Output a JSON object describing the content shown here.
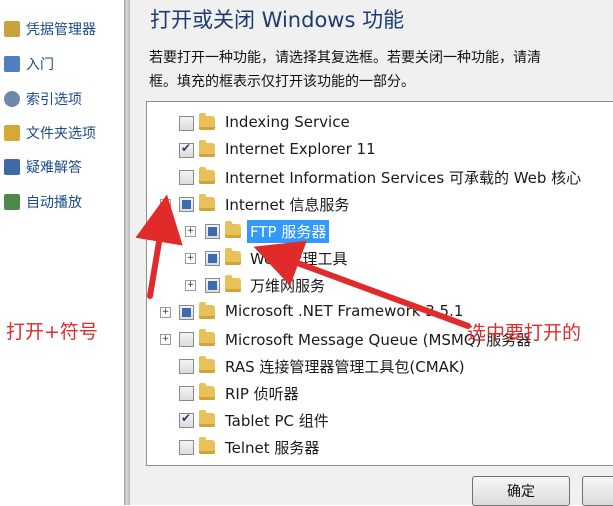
{
  "sidebar": {
    "items": [
      {
        "label": "凭据管理器",
        "icon": "credential-manager-icon",
        "color": "#c9a23c"
      },
      {
        "label": "入门",
        "icon": "getting-started-icon",
        "color": "#4f7fbf"
      },
      {
        "label": "索引选项",
        "icon": "indexing-options-icon",
        "color": "#6d88a8"
      },
      {
        "label": "文件夹选项",
        "icon": "folder-options-icon",
        "color": "#d4a935"
      },
      {
        "label": "疑难解答",
        "icon": "troubleshooting-icon",
        "color": "#3f6aa8"
      },
      {
        "label": "自动播放",
        "icon": "autoplay-icon",
        "color": "#4d8a4a"
      }
    ]
  },
  "dialog": {
    "title": "打开或关闭 Windows 功能",
    "description_line1": "若要打开一种功能，请选择其复选框。若要关闭一种功能，请清",
    "description_line2": "框。填充的框表示仅打开该功能的一部分。",
    "ok_label": "确定"
  },
  "features": [
    {
      "label": "Indexing Service",
      "state": "unchecked",
      "expander": "none",
      "level": 0
    },
    {
      "label": "Internet Explorer 11",
      "state": "checked",
      "expander": "none",
      "level": 0
    },
    {
      "label": "Internet Information Services 可承载的 Web 核心",
      "state": "unchecked",
      "expander": "none",
      "level": 0
    },
    {
      "label": "Internet 信息服务",
      "state": "partial",
      "expander": "minus",
      "level": 0
    },
    {
      "label": "FTP 服务器",
      "state": "partial",
      "expander": "plus",
      "level": 1,
      "selected": true
    },
    {
      "label": "Web 管理工具",
      "state": "partial",
      "expander": "plus",
      "level": 1
    },
    {
      "label": "万维网服务",
      "state": "partial",
      "expander": "plus",
      "level": 1
    },
    {
      "label": "Microsoft .NET Framework 3.5.1",
      "state": "partial",
      "expander": "plus",
      "level": 0
    },
    {
      "label": "Microsoft Message Queue (MSMQ) 服务器",
      "state": "unchecked",
      "expander": "plus",
      "level": 0
    },
    {
      "label": "RAS 连接管理器管理工具包(CMAK)",
      "state": "unchecked",
      "expander": "none",
      "level": 0
    },
    {
      "label": "RIP 侦听器",
      "state": "unchecked",
      "expander": "none",
      "level": 0
    },
    {
      "label": "Tablet PC 组件",
      "state": "checked",
      "expander": "none",
      "level": 0
    },
    {
      "label": "Telnet 服务器",
      "state": "unchecked",
      "expander": "none",
      "level": 0
    }
  ],
  "annotations": {
    "left": "打开+符号",
    "right": "选中要打开的",
    "color": "#e12b2b"
  }
}
